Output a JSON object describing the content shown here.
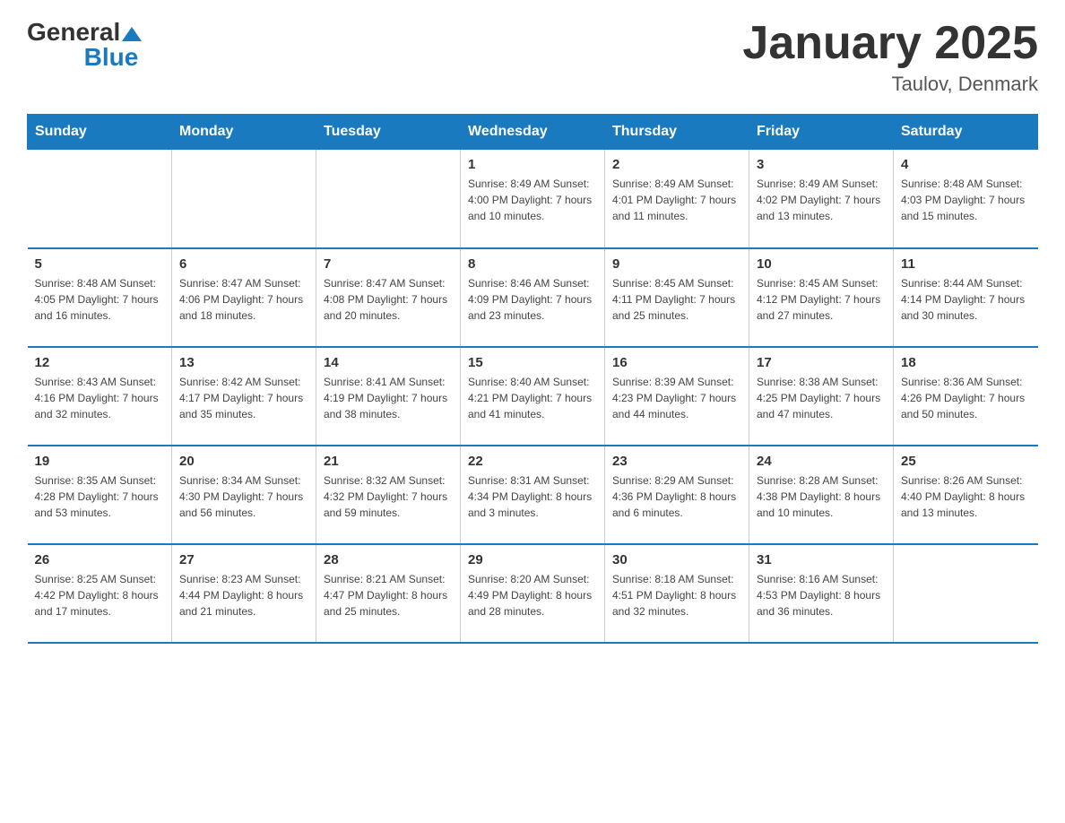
{
  "logo": {
    "text_general": "General",
    "text_blue": "Blue"
  },
  "title": "January 2025",
  "subtitle": "Taulov, Denmark",
  "days_of_week": [
    "Sunday",
    "Monday",
    "Tuesday",
    "Wednesday",
    "Thursday",
    "Friday",
    "Saturday"
  ],
  "weeks": [
    [
      {
        "day": "",
        "info": ""
      },
      {
        "day": "",
        "info": ""
      },
      {
        "day": "",
        "info": ""
      },
      {
        "day": "1",
        "info": "Sunrise: 8:49 AM\nSunset: 4:00 PM\nDaylight: 7 hours\nand 10 minutes."
      },
      {
        "day": "2",
        "info": "Sunrise: 8:49 AM\nSunset: 4:01 PM\nDaylight: 7 hours\nand 11 minutes."
      },
      {
        "day": "3",
        "info": "Sunrise: 8:49 AM\nSunset: 4:02 PM\nDaylight: 7 hours\nand 13 minutes."
      },
      {
        "day": "4",
        "info": "Sunrise: 8:48 AM\nSunset: 4:03 PM\nDaylight: 7 hours\nand 15 minutes."
      }
    ],
    [
      {
        "day": "5",
        "info": "Sunrise: 8:48 AM\nSunset: 4:05 PM\nDaylight: 7 hours\nand 16 minutes."
      },
      {
        "day": "6",
        "info": "Sunrise: 8:47 AM\nSunset: 4:06 PM\nDaylight: 7 hours\nand 18 minutes."
      },
      {
        "day": "7",
        "info": "Sunrise: 8:47 AM\nSunset: 4:08 PM\nDaylight: 7 hours\nand 20 minutes."
      },
      {
        "day": "8",
        "info": "Sunrise: 8:46 AM\nSunset: 4:09 PM\nDaylight: 7 hours\nand 23 minutes."
      },
      {
        "day": "9",
        "info": "Sunrise: 8:45 AM\nSunset: 4:11 PM\nDaylight: 7 hours\nand 25 minutes."
      },
      {
        "day": "10",
        "info": "Sunrise: 8:45 AM\nSunset: 4:12 PM\nDaylight: 7 hours\nand 27 minutes."
      },
      {
        "day": "11",
        "info": "Sunrise: 8:44 AM\nSunset: 4:14 PM\nDaylight: 7 hours\nand 30 minutes."
      }
    ],
    [
      {
        "day": "12",
        "info": "Sunrise: 8:43 AM\nSunset: 4:16 PM\nDaylight: 7 hours\nand 32 minutes."
      },
      {
        "day": "13",
        "info": "Sunrise: 8:42 AM\nSunset: 4:17 PM\nDaylight: 7 hours\nand 35 minutes."
      },
      {
        "day": "14",
        "info": "Sunrise: 8:41 AM\nSunset: 4:19 PM\nDaylight: 7 hours\nand 38 minutes."
      },
      {
        "day": "15",
        "info": "Sunrise: 8:40 AM\nSunset: 4:21 PM\nDaylight: 7 hours\nand 41 minutes."
      },
      {
        "day": "16",
        "info": "Sunrise: 8:39 AM\nSunset: 4:23 PM\nDaylight: 7 hours\nand 44 minutes."
      },
      {
        "day": "17",
        "info": "Sunrise: 8:38 AM\nSunset: 4:25 PM\nDaylight: 7 hours\nand 47 minutes."
      },
      {
        "day": "18",
        "info": "Sunrise: 8:36 AM\nSunset: 4:26 PM\nDaylight: 7 hours\nand 50 minutes."
      }
    ],
    [
      {
        "day": "19",
        "info": "Sunrise: 8:35 AM\nSunset: 4:28 PM\nDaylight: 7 hours\nand 53 minutes."
      },
      {
        "day": "20",
        "info": "Sunrise: 8:34 AM\nSunset: 4:30 PM\nDaylight: 7 hours\nand 56 minutes."
      },
      {
        "day": "21",
        "info": "Sunrise: 8:32 AM\nSunset: 4:32 PM\nDaylight: 7 hours\nand 59 minutes."
      },
      {
        "day": "22",
        "info": "Sunrise: 8:31 AM\nSunset: 4:34 PM\nDaylight: 8 hours\nand 3 minutes."
      },
      {
        "day": "23",
        "info": "Sunrise: 8:29 AM\nSunset: 4:36 PM\nDaylight: 8 hours\nand 6 minutes."
      },
      {
        "day": "24",
        "info": "Sunrise: 8:28 AM\nSunset: 4:38 PM\nDaylight: 8 hours\nand 10 minutes."
      },
      {
        "day": "25",
        "info": "Sunrise: 8:26 AM\nSunset: 4:40 PM\nDaylight: 8 hours\nand 13 minutes."
      }
    ],
    [
      {
        "day": "26",
        "info": "Sunrise: 8:25 AM\nSunset: 4:42 PM\nDaylight: 8 hours\nand 17 minutes."
      },
      {
        "day": "27",
        "info": "Sunrise: 8:23 AM\nSunset: 4:44 PM\nDaylight: 8 hours\nand 21 minutes."
      },
      {
        "day": "28",
        "info": "Sunrise: 8:21 AM\nSunset: 4:47 PM\nDaylight: 8 hours\nand 25 minutes."
      },
      {
        "day": "29",
        "info": "Sunrise: 8:20 AM\nSunset: 4:49 PM\nDaylight: 8 hours\nand 28 minutes."
      },
      {
        "day": "30",
        "info": "Sunrise: 8:18 AM\nSunset: 4:51 PM\nDaylight: 8 hours\nand 32 minutes."
      },
      {
        "day": "31",
        "info": "Sunrise: 8:16 AM\nSunset: 4:53 PM\nDaylight: 8 hours\nand 36 minutes."
      },
      {
        "day": "",
        "info": ""
      }
    ]
  ]
}
